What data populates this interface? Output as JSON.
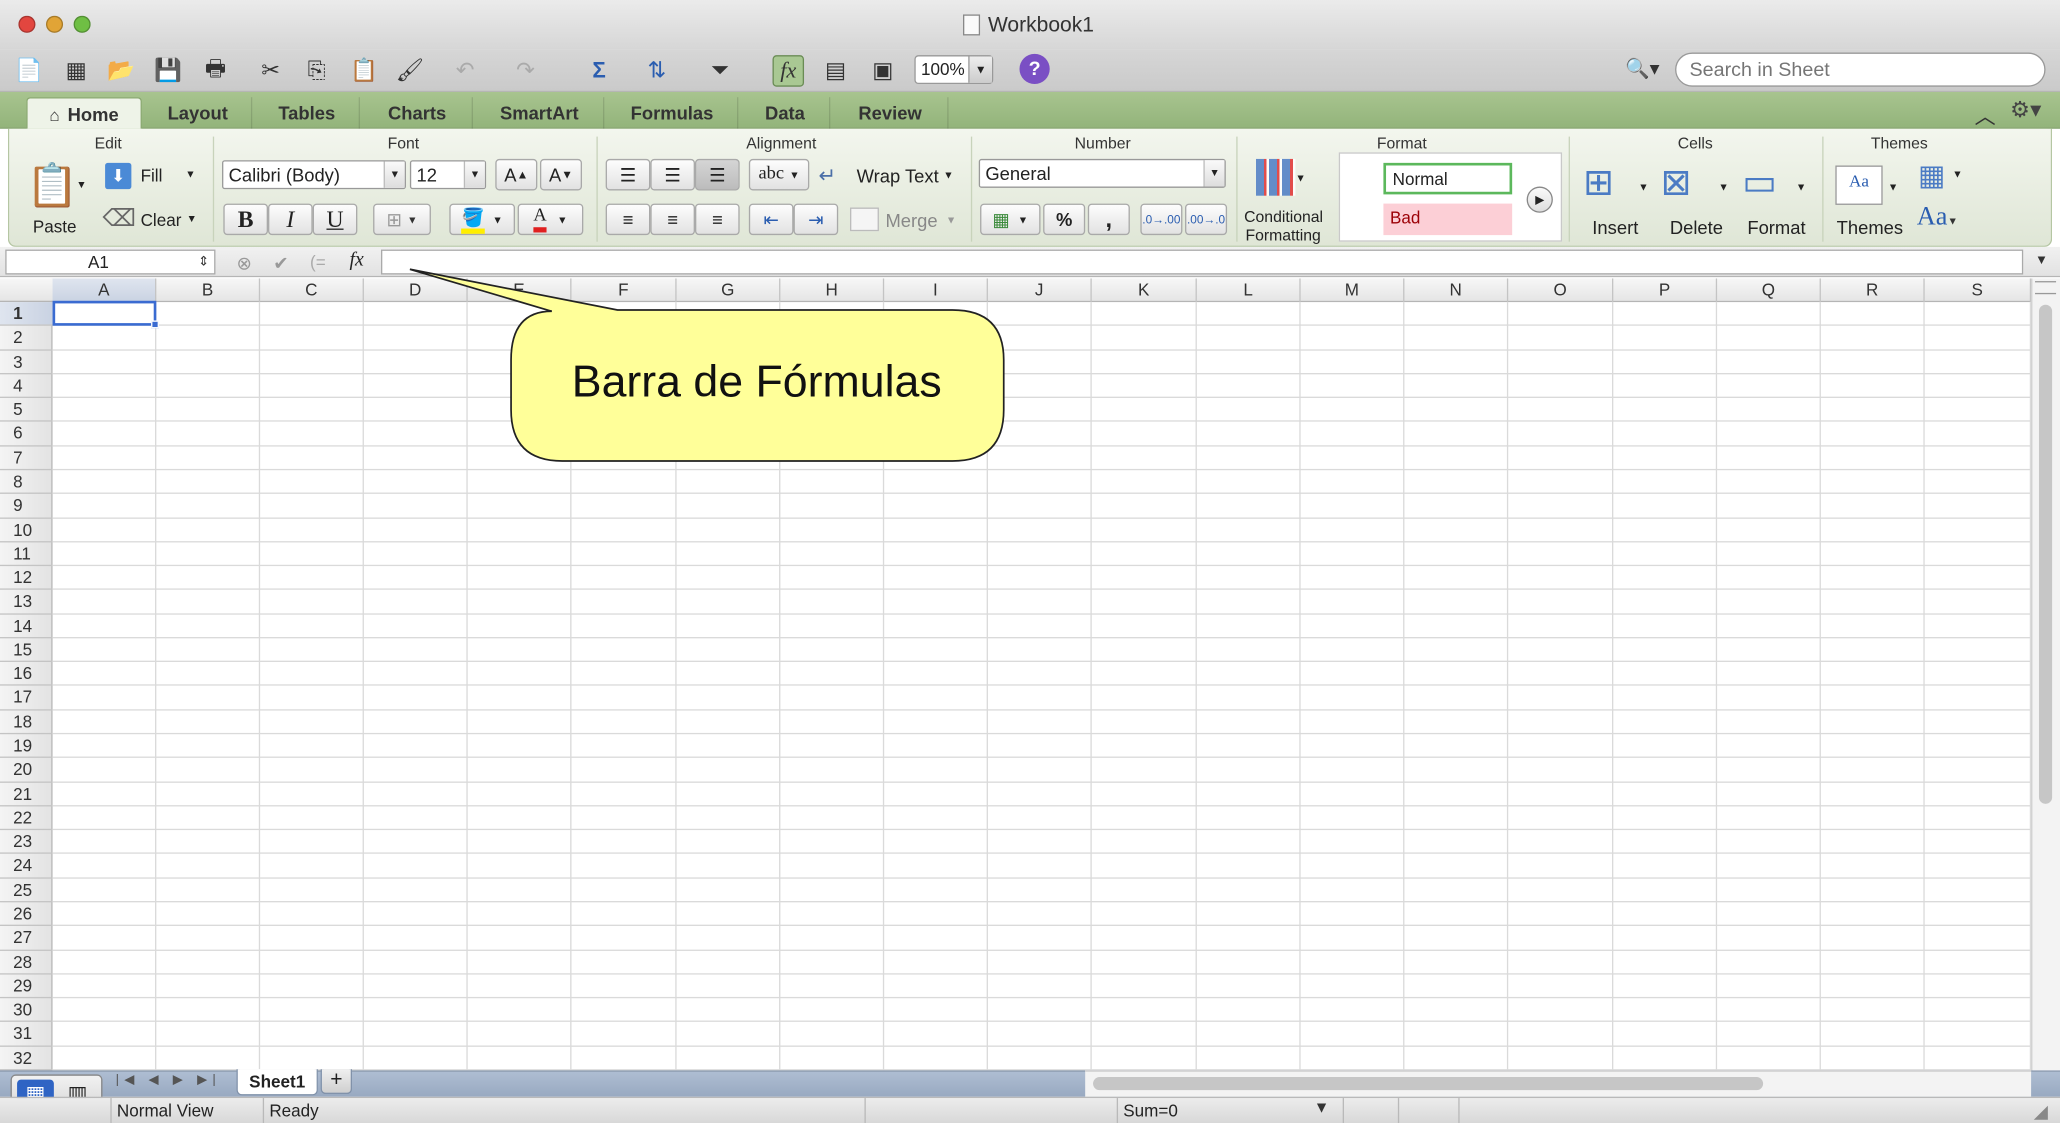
{
  "window": {
    "title": "Workbook1"
  },
  "toolbar": {
    "zoom": "100%",
    "help_label": "?"
  },
  "search": {
    "placeholder": "Search in Sheet"
  },
  "ribbon_tabs": [
    "Home",
    "Layout",
    "Tables",
    "Charts",
    "SmartArt",
    "Formulas",
    "Data",
    "Review"
  ],
  "ribbon": {
    "groups": {
      "edit": "Edit",
      "font": "Font",
      "alignment": "Alignment",
      "number": "Number",
      "format": "Format",
      "cells": "Cells",
      "themes": "Themes"
    },
    "edit": {
      "paste": "Paste",
      "fill": "Fill",
      "clear": "Clear"
    },
    "font": {
      "name": "Calibri (Body)",
      "size": "12",
      "bold": "B",
      "italic": "I",
      "underline": "U",
      "grow": "A",
      "shrink": "A",
      "color_glyph": "A"
    },
    "alignment": {
      "wrap_text": "Wrap Text",
      "merge": "Merge",
      "orientation": "abc"
    },
    "number": {
      "format": "General",
      "percent": "%",
      "comma": ",",
      "inc_decimal": ".0→.00",
      "dec_decimal": ".00→.0"
    },
    "format": {
      "conditional_line1": "Conditional",
      "conditional_line2": "Formatting",
      "style_normal": "Normal",
      "style_bad": "Bad"
    },
    "cells": {
      "insert": "Insert",
      "delete": "Delete",
      "format": "Format"
    },
    "themes": {
      "themes": "Themes",
      "font_glyph": "Aa",
      "preview_glyph": "Aa"
    }
  },
  "formula_bar": {
    "name_box": "A1",
    "fx": "fx",
    "value": ""
  },
  "grid": {
    "columns": [
      "A",
      "B",
      "C",
      "D",
      "E",
      "F",
      "G",
      "H",
      "I",
      "J",
      "K",
      "L",
      "M",
      "N",
      "O",
      "P",
      "Q",
      "R",
      "S"
    ],
    "rows": [
      "1",
      "2",
      "3",
      "4",
      "5",
      "6",
      "7",
      "8",
      "9",
      "10",
      "11",
      "12",
      "13",
      "14",
      "15",
      "16",
      "17",
      "18",
      "19",
      "20",
      "21",
      "22",
      "23",
      "24",
      "25",
      "26",
      "27",
      "28",
      "29",
      "30",
      "31",
      "32"
    ],
    "selected_cell": "A1"
  },
  "sheets": [
    "Sheet1"
  ],
  "add_sheet": "+",
  "status": {
    "view": "Normal View",
    "state": "Ready",
    "sum": "Sum=0"
  },
  "callout": {
    "text": "Barra de Fórmulas"
  },
  "colors": {
    "ribbon_green": "#9dbd84",
    "selection_blue": "#3a6bd1",
    "callout_fill": "#ffff99",
    "bad_fill": "#fccfd6",
    "normal_border": "#5cb85c"
  }
}
